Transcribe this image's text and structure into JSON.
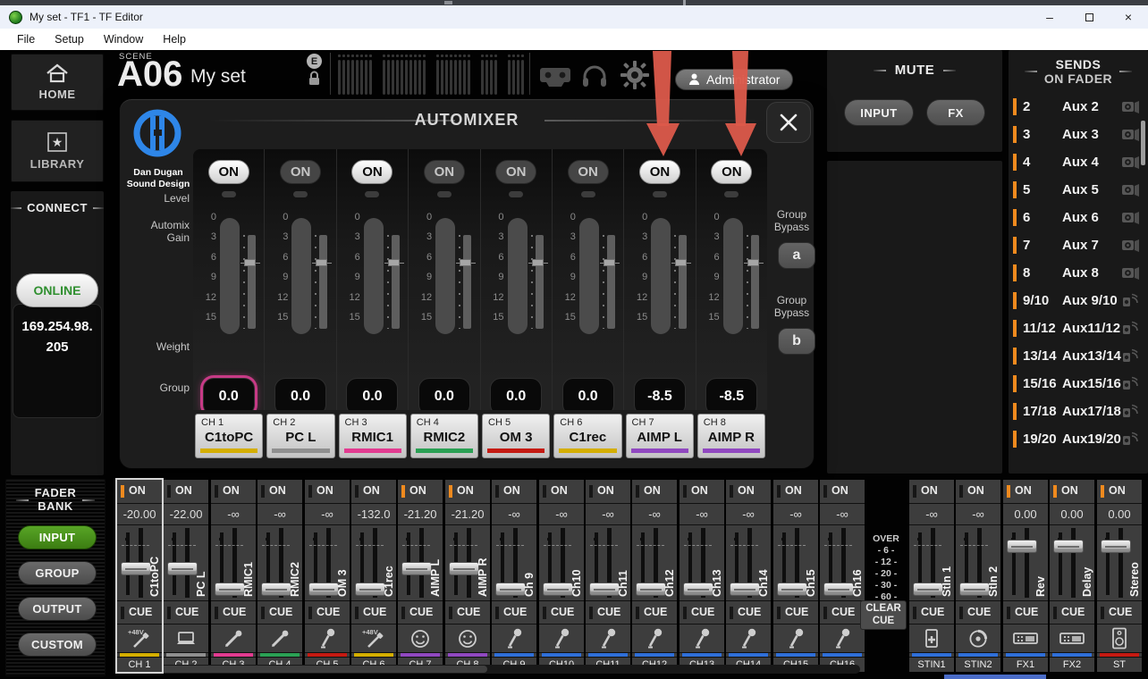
{
  "window": {
    "title": "My set - TF1 - TF Editor",
    "controls": [
      "minimize",
      "maximize",
      "close"
    ]
  },
  "menu": {
    "items": [
      "File",
      "Setup",
      "Window",
      "Help"
    ]
  },
  "topbar": {
    "scene_label": "SCENE",
    "scene_id": "A06",
    "scene_name": "My set",
    "edit_badge": "E",
    "user": "Administrator",
    "icons": [
      "lock-icon",
      "recorder-icon",
      "headphones-icon",
      "settings-gear-icon",
      "user-icon"
    ]
  },
  "sidebar": {
    "home": "HOME",
    "library": "LIBRARY",
    "connect": "CONNECT",
    "online": "ONLINE",
    "ip": "169.254.98.205",
    "fader_bank": "FADER BANK",
    "bank_buttons": [
      {
        "label": "INPUT",
        "active": true
      },
      {
        "label": "GROUP",
        "active": false
      },
      {
        "label": "OUTPUT",
        "active": false
      },
      {
        "label": "CUSTOM",
        "active": false
      }
    ]
  },
  "automixer": {
    "title": "AUTOMIXER",
    "brand_line1": "Dan Dugan",
    "brand_line2": "Sound Design",
    "on_label": "ON",
    "labels": {
      "level": "Level",
      "automix": "Automix",
      "gain": "Gain",
      "weight": "Weight",
      "group": "Group"
    },
    "meter_scale": [
      "0",
      "3",
      "6",
      "9",
      "12",
      "15"
    ],
    "group_bypass": {
      "label_line1": "Group",
      "label_line2": "Bypass",
      "a": "a",
      "b": "b"
    },
    "channels": [
      {
        "ch": "CH 1",
        "name": "C1toPC",
        "on": true,
        "weight": "0.0",
        "group": "a",
        "color": "#d4ae00",
        "selected": true
      },
      {
        "ch": "CH 2",
        "name": "PC L",
        "on": false,
        "weight": "0.0",
        "group": "a",
        "color": "#8f8f8f",
        "selected": false
      },
      {
        "ch": "CH 3",
        "name": "RMIC1",
        "on": true,
        "weight": "0.0",
        "group": "a",
        "color": "#e23b90",
        "selected": false
      },
      {
        "ch": "CH 4",
        "name": "RMIC2",
        "on": false,
        "weight": "0.0",
        "group": "a",
        "color": "#2aa054",
        "selected": false
      },
      {
        "ch": "CH 5",
        "name": "OM 3",
        "on": false,
        "weight": "0.0",
        "group": "a",
        "color": "#c51a12",
        "selected": false
      },
      {
        "ch": "CH 6",
        "name": "C1rec",
        "on": false,
        "weight": "0.0",
        "group": "a",
        "color": "#d4ae00",
        "selected": false
      },
      {
        "ch": "CH 7",
        "name": "AIMP L",
        "on": true,
        "weight": "-8.5",
        "group": "a",
        "color": "#9048c0",
        "selected": false
      },
      {
        "ch": "CH 8",
        "name": "AIMP R",
        "on": true,
        "weight": "-8.5",
        "group": "a",
        "color": "#9048c0",
        "selected": false
      }
    ]
  },
  "mute": {
    "title": "MUTE",
    "buttons": [
      "INPUT",
      "FX"
    ]
  },
  "sends": {
    "line1": "SENDS",
    "line2": "ON FADER",
    "items": [
      {
        "num": "2",
        "name": "Aux 2",
        "icon": "speaker"
      },
      {
        "num": "3",
        "name": "Aux 3",
        "icon": "speaker"
      },
      {
        "num": "4",
        "name": "Aux 4",
        "icon": "speaker"
      },
      {
        "num": "5",
        "name": "Aux 5",
        "icon": "speaker"
      },
      {
        "num": "6",
        "name": "Aux 6",
        "icon": "speaker"
      },
      {
        "num": "7",
        "name": "Aux 7",
        "icon": "speaker"
      },
      {
        "num": "8",
        "name": "Aux 8",
        "icon": "speaker"
      },
      {
        "num": "9/10",
        "name": "Aux 9/10",
        "icon": "stereo"
      },
      {
        "num": "11/12",
        "name": "Aux11/12",
        "icon": "stereo"
      },
      {
        "num": "13/14",
        "name": "Aux13/14",
        "icon": "stereo"
      },
      {
        "num": "15/16",
        "name": "Aux15/16",
        "icon": "stereo"
      },
      {
        "num": "17/18",
        "name": "Aux17/18",
        "icon": "stereo"
      },
      {
        "num": "19/20",
        "name": "Aux19/20",
        "icon": "stereo"
      }
    ]
  },
  "bottom": {
    "on_label": "ON",
    "cue_label": "CUE",
    "meter_legend": [
      "OVER",
      "- 6 -",
      "- 12 -",
      "- 20 -",
      "- 30 -",
      "- 60 -"
    ],
    "clear_cue": "CLEAR CUE",
    "strips": [
      {
        "id": "CH 1",
        "name": "C1toPC",
        "on": true,
        "value": "-20.00",
        "icon": "di48v",
        "color": "#d4ae00",
        "fader": 0.6,
        "selected": true
      },
      {
        "id": "CH 2",
        "name": "PC L",
        "on": false,
        "value": "-22.00",
        "icon": "laptop",
        "color": "#8f8f8f",
        "fader": 0.6,
        "selected": false
      },
      {
        "id": "CH 3",
        "name": "RMIC1",
        "on": false,
        "value": "-∞",
        "icon": "micpen",
        "color": "#e23b90",
        "fader": 1.0,
        "selected": false
      },
      {
        "id": "CH 4",
        "name": "RMIC2",
        "on": false,
        "value": "-∞",
        "icon": "micpen",
        "color": "#2aa054",
        "fader": 1.0,
        "selected": false
      },
      {
        "id": "CH 5",
        "name": "OM 3",
        "on": false,
        "value": "-∞",
        "icon": "mic",
        "color": "#c51a12",
        "fader": 1.0,
        "selected": false
      },
      {
        "id": "CH 6",
        "name": "C1rec",
        "on": false,
        "value": "-132.0",
        "icon": "di48v",
        "color": "#d4ae00",
        "fader": 1.0,
        "selected": false
      },
      {
        "id": "CH 7",
        "name": "AIMP L",
        "on": true,
        "value": "-21.20",
        "icon": "smiley",
        "color": "#9048c0",
        "fader": 0.6,
        "selected": false
      },
      {
        "id": "CH 8",
        "name": "AIMP R",
        "on": true,
        "value": "-21.20",
        "icon": "smiley",
        "color": "#9048c0",
        "fader": 0.6,
        "selected": false
      },
      {
        "id": "CH 9",
        "name": "Ch 9",
        "on": false,
        "value": "-∞",
        "icon": "mic",
        "color": "#2f6fd8",
        "fader": 1.0,
        "selected": false
      },
      {
        "id": "CH10",
        "name": "Ch10",
        "on": false,
        "value": "-∞",
        "icon": "mic",
        "color": "#2f6fd8",
        "fader": 1.0,
        "selected": false
      },
      {
        "id": "CH11",
        "name": "Ch11",
        "on": false,
        "value": "-∞",
        "icon": "mic",
        "color": "#2f6fd8",
        "fader": 1.0,
        "selected": false
      },
      {
        "id": "CH12",
        "name": "Ch12",
        "on": false,
        "value": "-∞",
        "icon": "mic",
        "color": "#2f6fd8",
        "fader": 1.0,
        "selected": false
      },
      {
        "id": "CH13",
        "name": "Ch13",
        "on": false,
        "value": "-∞",
        "icon": "mic",
        "color": "#2f6fd8",
        "fader": 1.0,
        "selected": false
      },
      {
        "id": "CH14",
        "name": "Ch14",
        "on": false,
        "value": "-∞",
        "icon": "mic",
        "color": "#2f6fd8",
        "fader": 1.0,
        "selected": false
      },
      {
        "id": "CH15",
        "name": "Ch15",
        "on": false,
        "value": "-∞",
        "icon": "mic",
        "color": "#2f6fd8",
        "fader": 1.0,
        "selected": false
      },
      {
        "id": "CH16",
        "name": "Ch16",
        "on": false,
        "value": "-∞",
        "icon": "mic",
        "color": "#2f6fd8",
        "fader": 1.0,
        "selected": false
      },
      {
        "id": "STIN1",
        "name": "StIn 1",
        "on": false,
        "value": "-∞",
        "icon": "media",
        "color": "#2f6fd8",
        "fader": 1.0,
        "selected": false
      },
      {
        "id": "STIN2",
        "name": "StIn 2",
        "on": false,
        "value": "-∞",
        "icon": "disc",
        "color": "#2f6fd8",
        "fader": 1.0,
        "selected": false
      },
      {
        "id": "FX1",
        "name": "Rev",
        "on": true,
        "value": "0.00",
        "icon": "fx",
        "color": "#2f6fd8",
        "fader": 0.17,
        "selected": false
      },
      {
        "id": "FX2",
        "name": "Delay",
        "on": true,
        "value": "0.00",
        "icon": "fx",
        "color": "#2f6fd8",
        "fader": 0.17,
        "selected": false
      },
      {
        "id": "ST",
        "name": "Stereo",
        "on": true,
        "value": "0.00",
        "icon": "speaker",
        "color": "#c51a12",
        "fader": 0.17,
        "selected": false
      }
    ]
  },
  "colors": {
    "accent_orange": "#f08a1e",
    "accent_green": "#4a9a1c",
    "online_green": "#2f8f2f",
    "select_pink": "#c73a86",
    "channel_blue": "#2f6fd8",
    "arrow_red": "#dc5a4b",
    "logo_blue": "#2e86e8"
  }
}
